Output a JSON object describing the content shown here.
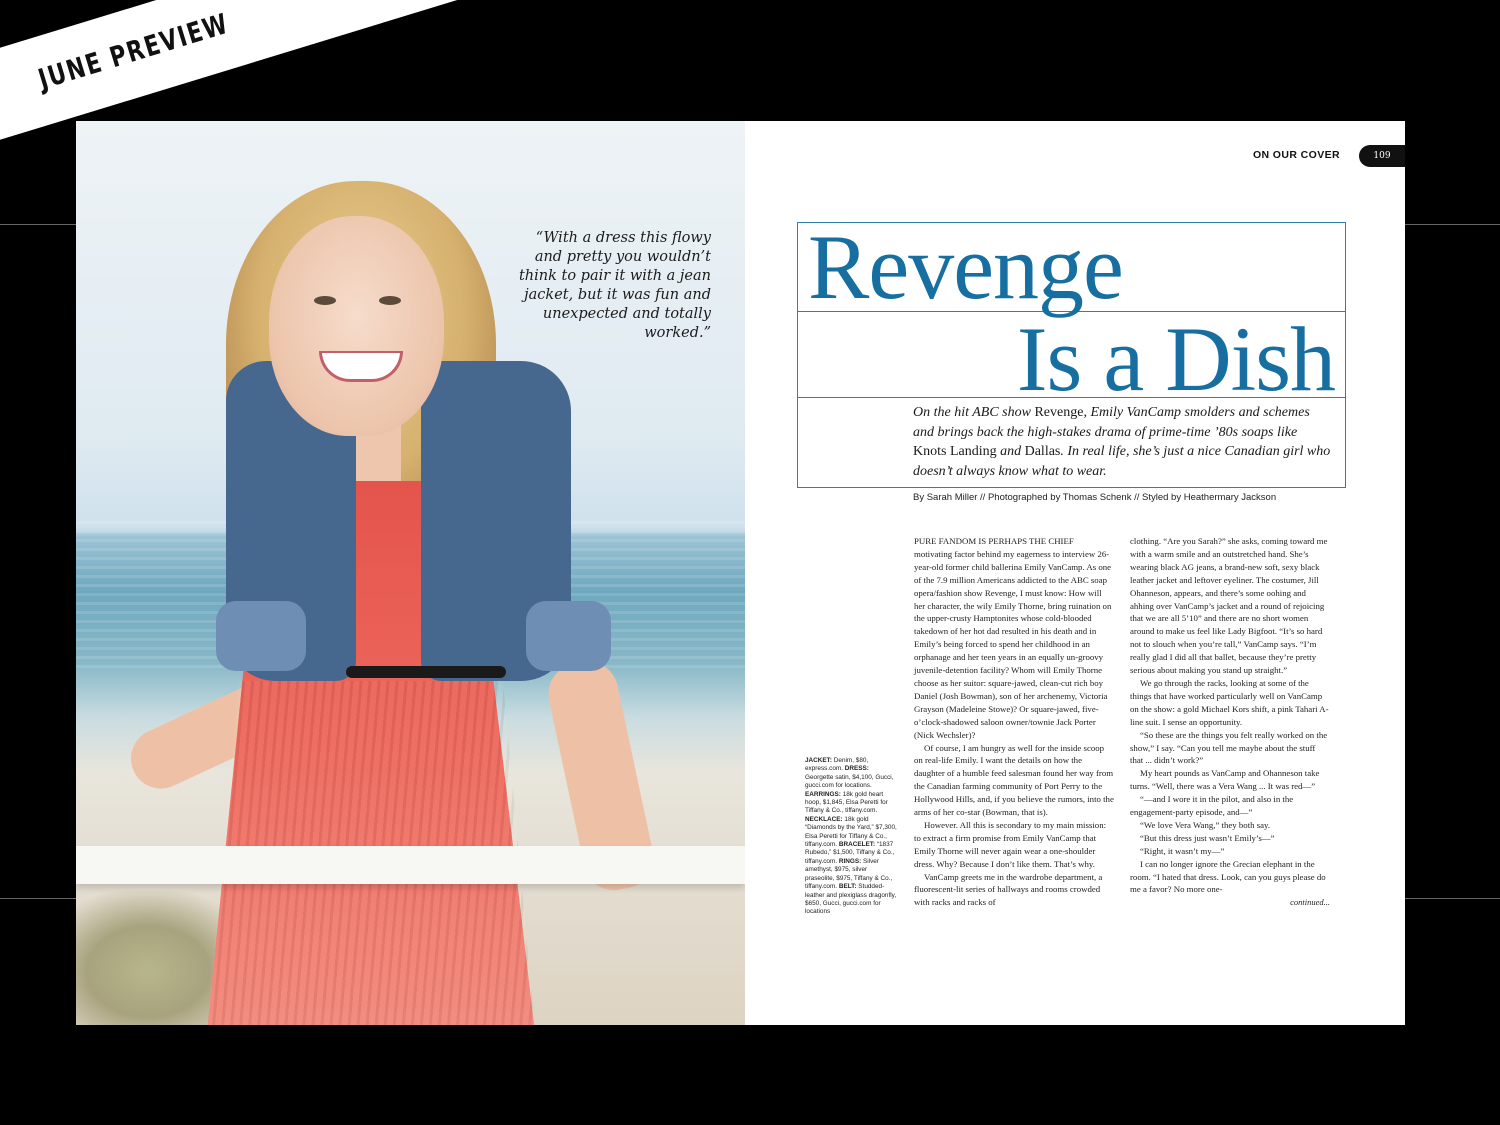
{
  "banner": {
    "label": "JUNE PREVIEW"
  },
  "left_page": {
    "pull_quote": "“With a dress this flowy and pretty you wouldn’t think to pair it with a jean jacket, but it was fun and unexpected and totally worked.”"
  },
  "right_page": {
    "section_label": "ON OUR COVER",
    "page_number": "109",
    "headline_line1": "Revenge",
    "headline_line2": "Is a Dish",
    "deck": {
      "part1": "On the hit ABC show ",
      "show1": "Revenge",
      "part2": ", Emily VanCamp smolders and schemes and brings back the high-stakes drama of prime-time ’80s soaps like ",
      "show2": "Knots Landing",
      "part3": " and ",
      "show3": "Dallas",
      "part4": ". In real life, she’s just a nice Canadian girl who doesn’t always know what to wear."
    },
    "byline": "By Sarah Miller // Photographed by Thomas Schenk // Styled by Heathermary Jackson",
    "credits": {
      "jacket_label": "JACKET:",
      "jacket": " Denim, $80, express.com. ",
      "dress_label": "DRESS:",
      "dress": " Georgette satin, $4,100, Gucci, gucci.com for locations. ",
      "earrings_label": "EARRINGS:",
      "earrings": " 18k gold heart hoop, $1,845, Elsa Peretti for Tiffany & Co., tiffany.com. ",
      "necklace_label": "NECKLACE:",
      "necklace": " 18k gold “Diamonds by the Yard,” $7,300, Elsa Peretti for Tiffany & Co., tiffany.com. ",
      "bracelet_label": "BRACELET:",
      "bracelet": " “1837 Rubedo,” $1,500, Tiffany & Co., tiffany.com. ",
      "rings_label": "RINGS:",
      "rings": " Silver amethyst, $975, silver praseolite, $975, Tiffany & Co., tiffany.com. ",
      "belt_label": "BELT:",
      "belt": " Studded-leather and plexiglass dragonfly, $650, Gucci, gucci.com for locations"
    },
    "column1": [
      "PURE FANDOM IS PERHAPS THE CHIEF motivating factor behind my eagerness to interview 26-year-old former child ballerina Emily VanCamp. As one of the 7.9 million Americans addicted to the ABC soap opera/fashion show Revenge, I must know: How will her character, the wily Emily Thorne, bring ruination on the upper-crusty Hamptonites whose cold-blooded takedown of her hot dad resulted in his death and in Emily’s being forced to spend her childhood in an orphanage and her teen years in an equally un-groovy juvenile-detention facility? Whom will Emily Thorne choose as her suitor: square-jawed, clean-cut rich boy Daniel (Josh Bowman), son of her archenemy, Victoria Grayson (Madeleine Stowe)? Or square-jawed, five-o’clock-shadowed saloon owner/townie Jack Porter (Nick Wechsler)?",
      "Of course, I am hungry as well for the inside scoop on real-life Emily. I want the details on how the daughter of a humble feed salesman found her way from the Canadian farming community of Port Perry to the Hollywood Hills, and, if you believe the rumors, into the arms of her co-star (Bowman, that is).",
      "However. All this is secondary to my main mission: to extract a firm promise from Emily VanCamp that Emily Thorne will never again wear a one-shoulder dress. Why? Because I don’t like them. That’s why.",
      "VanCamp greets me in the wardrobe department, a fluorescent-lit series of hallways and rooms crowded with racks and racks of"
    ],
    "column2": [
      "clothing. “Are you Sarah?” she asks, coming toward me with a warm smile and an outstretched hand. She’s wearing black AG jeans, a brand-new soft, sexy black leather jacket and leftover eyeliner. The costumer, Jill Ohanneson, appears, and there’s some oohing and ahhing over VanCamp’s jacket and a round of rejoicing that we are all 5’10” and there are no short women around to make us feel like Lady Bigfoot. “It’s so hard not to slouch when you’re tall,” VanCamp says. “I’m really glad I did all that ballet, because they’re pretty serious about making you stand up straight.”",
      "We go through the racks, looking at some of the things that have worked particularly well on VanCamp on the show: a gold Michael Kors shift, a pink Tahari A-line suit. I sense an opportunity.",
      "“So these are the things you felt really worked on the show,” I say. “Can you tell me maybe about the stuff that ... didn’t work?”",
      "My heart pounds as VanCamp and Ohanneson take turns. “Well, there was a Vera Wang ... It was red—”",
      "“—and I wore it in the pilot, and also in the engagement-party episode, and—”",
      "“We love Vera Wang,” they both say.",
      "“But this dress just wasn’t Emily’s—”",
      "“Right, it wasn’t my—”",
      "I can no longer ignore the Grecian elephant in the room. “I hated that dress. Look, can you guys please do me a favor? No more one-"
    ],
    "continued": "continued..."
  },
  "colors": {
    "headline_blue": "#176ea0",
    "rule_blue": "#2f7fa9",
    "dress_coral": "#e4544c",
    "denim": "#46678e"
  }
}
